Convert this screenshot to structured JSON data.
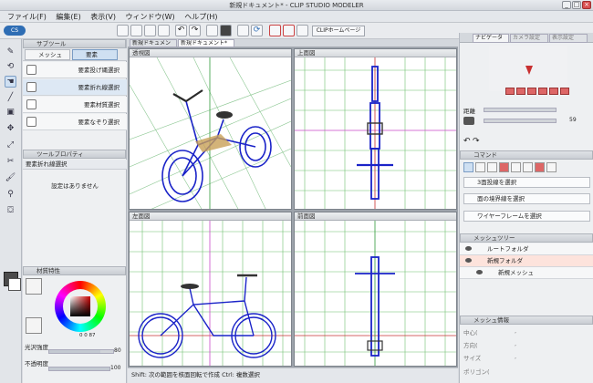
{
  "window": {
    "title": "新規ドキュメント* - CLIP STUDIO MODELER",
    "min": "_",
    "max": "□",
    "close": "×"
  },
  "menu": [
    "ファイル(F)",
    "編集(E)",
    "表示(V)",
    "ウィンドウ(W)",
    "ヘルプ(H)"
  ],
  "toolbar": {
    "home_button": "CLIPホームページ",
    "doc_tabs": [
      "新規ドキュメン",
      "新規ドキュメント*"
    ]
  },
  "subtool": {
    "panel_title": "サブツール",
    "tabs": [
      "メッシュ",
      "要素"
    ],
    "items": [
      "要素投げ縄選択",
      "要素折れ線選択",
      "要素材質選択",
      "要素なぞり選択"
    ]
  },
  "tool_property": {
    "panel_title": "ツールプロパティ",
    "tool_name": "要素折れ線選択",
    "empty_message": "設定はありません"
  },
  "material": {
    "panel_title": "材質特性",
    "gloss_label": "光沢強度",
    "gloss_value": "80",
    "opacity_label": "不透明度",
    "opacity_value": "100",
    "color_values": [
      "0",
      "0",
      "87"
    ]
  },
  "viewports": {
    "perspective": {
      "label": "透視図"
    },
    "top": {
      "label": "上面図"
    },
    "left": {
      "label": "左面図"
    },
    "front": {
      "label": "前面図"
    }
  },
  "navigator": {
    "tabs": [
      "ナビゲータ",
      "カメラ設定",
      "表示設定"
    ],
    "distance_label": "距離",
    "fov_value": "59"
  },
  "command": {
    "panel_title": "コマンド",
    "items": [
      "3面投線を選択",
      "面の境界線を選択",
      "ワイヤーフレームを選択"
    ]
  },
  "mesh_tree": {
    "panel_title": "メッシュツリー",
    "root": "ルートフォルダ",
    "folder": "新規フォルダ",
    "mesh": "新規メッシュ"
  },
  "mesh_info": {
    "panel_title": "メッシュ情報",
    "labels": [
      "中心(",
      "方向(",
      "サイズ",
      "ポリゴン("
    ],
    "fields": [
      ",",
      ",",
      ","
    ]
  },
  "status": {
    "text": "Shift: 次の範囲を核面回転で作成  Ctrl: 複数選択"
  },
  "colors": {
    "accent": "#2e6db4",
    "wire": "#1a23c8",
    "grid_major": "#2f9a3a",
    "grid_minor": "#9fd49f",
    "axis_red": "#c83030",
    "axis_magenta": "#c848c8"
  }
}
